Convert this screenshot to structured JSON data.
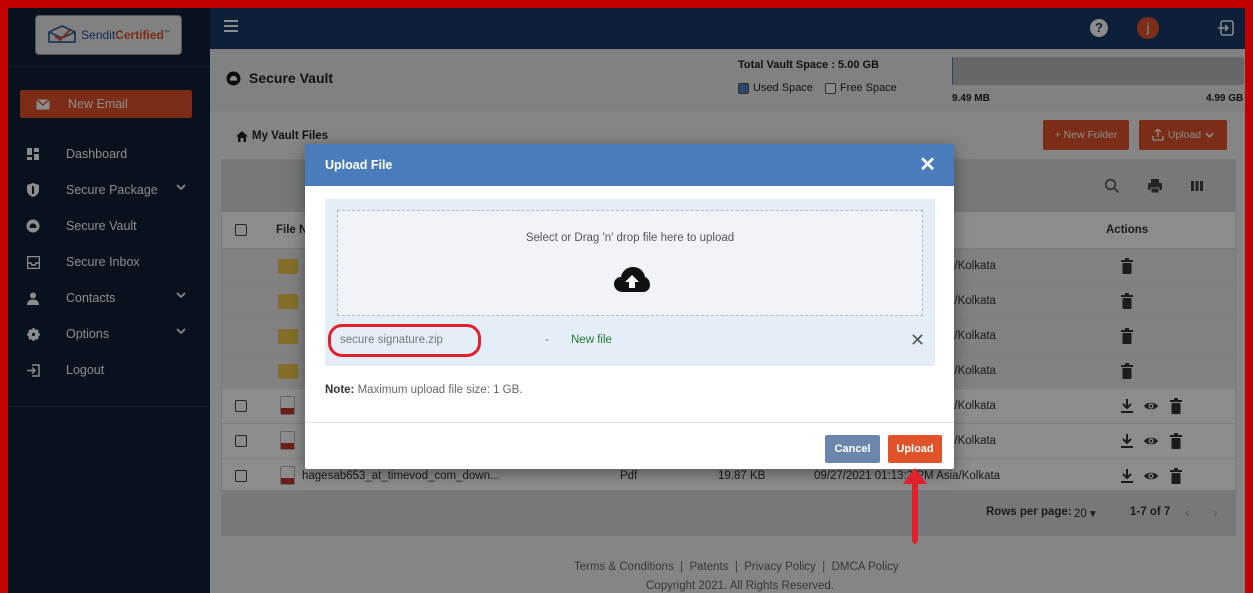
{
  "app": {
    "logo_text_1": "Sendit",
    "logo_text_2": "Certified",
    "logo_tm": "™"
  },
  "sidebar": {
    "new_email": "New Email",
    "items": [
      {
        "label": "Dashboard",
        "icon": "dashboard-icon"
      },
      {
        "label": "Secure Package",
        "icon": "shield-icon",
        "expand": true
      },
      {
        "label": "Secure Vault",
        "icon": "vault-icon"
      },
      {
        "label": "Secure Inbox",
        "icon": "inbox-icon"
      },
      {
        "label": "Contacts",
        "icon": "contacts-icon",
        "expand": true
      },
      {
        "label": "Options",
        "icon": "gear-icon",
        "expand": true
      },
      {
        "label": "Logout",
        "icon": "logout-icon"
      }
    ]
  },
  "topbar": {
    "help": "?",
    "avatar_letter": "j"
  },
  "header": {
    "title": "Secure Vault",
    "total_space": "Total Vault Space : 5.00 GB",
    "used_label": "Used Space",
    "free_label": "Free Space",
    "used_value": "9.49 MB",
    "free_value": "4.99 GB",
    "used_fraction": 0.0019
  },
  "breadcrumb": "My Vault Files",
  "buttons": {
    "new_folder": "+ New Folder",
    "upload": "Upload"
  },
  "table": {
    "col_file": "File N",
    "col_actions": "Actions",
    "rows": [
      {
        "type": "folder",
        "tz": "a/Kolkata",
        "checkbox": false
      },
      {
        "type": "folder",
        "tz": "a/Kolkata",
        "checkbox": false
      },
      {
        "type": "folder",
        "tz": "a/Kolkata",
        "checkbox": false
      },
      {
        "type": "folder",
        "tz": "a/Kolkata",
        "checkbox": false
      },
      {
        "type": "jpg",
        "tz": "a/Kolkata",
        "checkbox": true
      },
      {
        "type": "jpg",
        "tz": "a/Kolkata",
        "checkbox": true
      },
      {
        "type": "pdf",
        "name": "hagesab653_at_timevod_com_down...",
        "format": "Pdf",
        "size": "19.87 KB",
        "tz": "09/27/2021 01:13:2 PM Asia/Kolkata",
        "checkbox": true
      }
    ],
    "rows_per_page_label": "Rows per page:",
    "rows_per_page": "20",
    "range": "1-7 of 7"
  },
  "footer": {
    "links": "Terms & Conditions  |  Patents  |  Privacy Policy  |  DMCA Policy",
    "copyright": "Copyright 2021. All Rights Reserved."
  },
  "modal": {
    "title": "Upload File",
    "drop_text": "Select or Drag 'n' drop file here to upload",
    "file_name": "secure signature.zip",
    "dash": "-",
    "file_status": "New file",
    "note_label": "Note:",
    "note_text": " Maximum upload file size: 1 GB.",
    "cancel": "Cancel",
    "upload": "Upload"
  },
  "colors": {
    "accent": "#e0532a",
    "topbar": "#1b3a6b",
    "sidebar": "#0f2138",
    "modal_header": "#4a7cbc",
    "highlight": "#e2202a"
  }
}
